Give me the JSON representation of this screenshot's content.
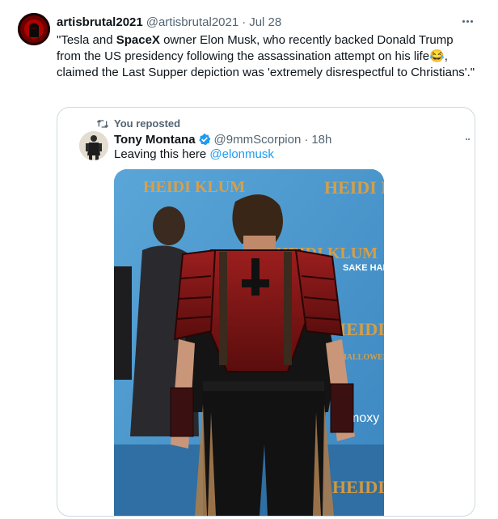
{
  "tweet": {
    "display_name": "artisbrutal2021",
    "handle": "@artisbrutal2021",
    "separator": "·",
    "date": "Jul 28",
    "text_parts": {
      "p1": "\"Tesla and ",
      "spacex": "SpaceX",
      "p2": " owner Elon Musk, who recently backed Donald Trump from  the US presidency following the assassination attempt on his life",
      "emoji": "😂",
      "p3": ", claimed the Last Supper depiction was 'extremely disrespectful to Christians'.\""
    }
  },
  "quote": {
    "reposted_label": "You reposted",
    "display_name": "Tony Montana",
    "handle": "@9mmScorpion",
    "separator": "·",
    "time": "18h",
    "text": "Leaving this here ",
    "mention": "@elonmusk"
  },
  "media": {
    "backdrop_wordmarks": [
      "HEIDI KLUM",
      "HALLOWEEN",
      "SAKE HANA",
      "moxy"
    ]
  },
  "colors": {
    "accent": "#1d9bf0",
    "secondary_text": "#536471",
    "border": "#cfd9de",
    "backdrop_blue": "#4b95c9"
  },
  "icons": {
    "more": "more-horizontal-icon",
    "repost": "repost-icon",
    "verified": "verified-badge-icon"
  }
}
